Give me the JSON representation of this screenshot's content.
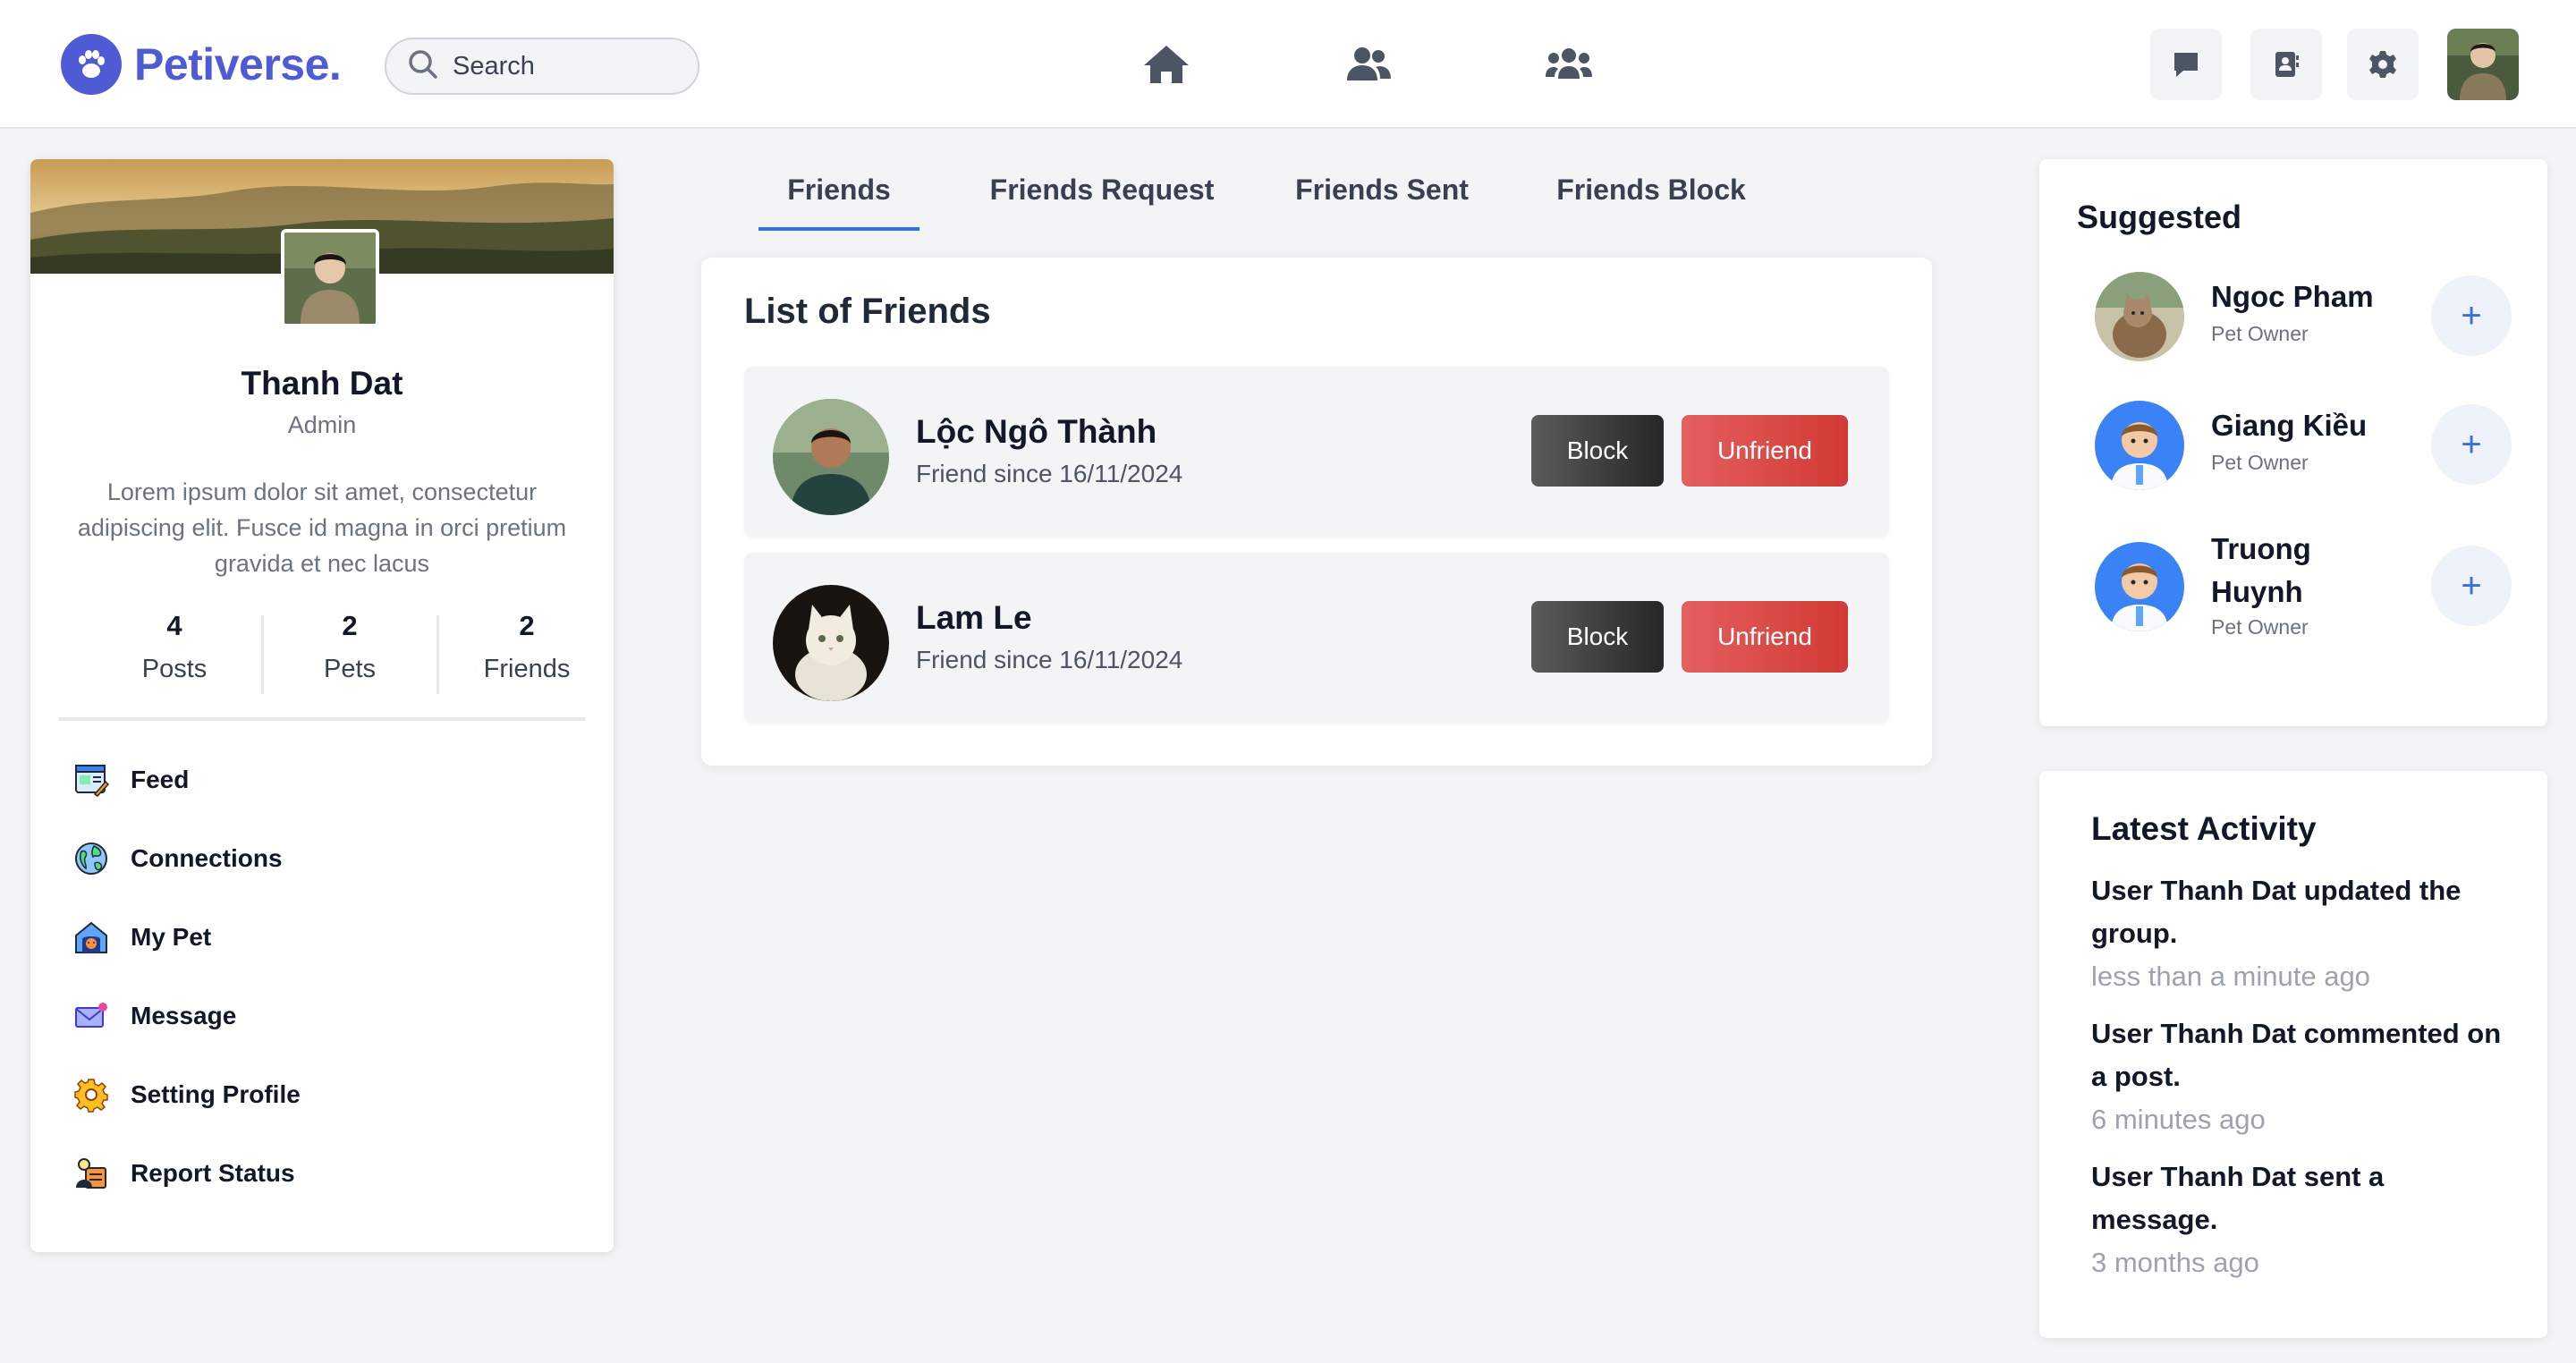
{
  "brand": {
    "name": "Petiverse.",
    "color": "#4f5bd5"
  },
  "search": {
    "placeholder": "Search"
  },
  "nav": {
    "icons": [
      "home-icon",
      "friends-icon",
      "groups-icon"
    ]
  },
  "header_actions": [
    "message-icon",
    "contacts-icon",
    "settings-icon",
    "user-avatar"
  ],
  "profile": {
    "name": "Thanh Dat",
    "role": "Admin",
    "bio": "Lorem ipsum dolor sit amet, consectetur adipiscing elit. Fusce id magna in orci pretium gravida et nec lacus",
    "stats": [
      {
        "value": "4",
        "label": "Posts"
      },
      {
        "value": "2",
        "label": "Pets"
      },
      {
        "value": "2",
        "label": "Friends"
      }
    ]
  },
  "menu": [
    {
      "label": "Feed",
      "icon": "feed-icon"
    },
    {
      "label": "Connections",
      "icon": "globe-icon"
    },
    {
      "label": "My Pet",
      "icon": "pet-house-icon"
    },
    {
      "label": "Message",
      "icon": "envelope-icon"
    },
    {
      "label": "Setting Profile",
      "icon": "gear-icon"
    },
    {
      "label": "Report Status",
      "icon": "report-icon"
    }
  ],
  "tabs": [
    {
      "label": "Friends",
      "active": true
    },
    {
      "label": "Friends Request",
      "active": false
    },
    {
      "label": "Friends Sent",
      "active": false
    },
    {
      "label": "Friends Block",
      "active": false
    }
  ],
  "friends_list": {
    "title": "List of Friends",
    "block_label": "Block",
    "unfriend_label": "Unfriend",
    "items": [
      {
        "name": "Lộc Ngô Thành",
        "since": "Friend since 16/11/2024"
      },
      {
        "name": "Lam Le",
        "since": "Friend since 16/11/2024"
      }
    ]
  },
  "suggested": {
    "title": "Suggested",
    "items": [
      {
        "name": "Ngoc Pham",
        "role": "Pet Owner"
      },
      {
        "name": "Giang Kiều",
        "role": "Pet Owner"
      },
      {
        "name": "Truong Huynh",
        "role": "Pet Owner"
      }
    ]
  },
  "activity": {
    "title": "Latest Activity",
    "items": [
      {
        "text": "User Thanh Dat updated the group.",
        "time": "less than a minute ago"
      },
      {
        "text": "User Thanh Dat commented on a post.",
        "time": "6 minutes ago"
      },
      {
        "text": "User Thanh Dat sent a message.",
        "time": "3 months ago"
      }
    ]
  },
  "colors": {
    "accent": "#3b6fd6",
    "danger": "#d23a34",
    "dark": "#262626",
    "background": "#f3f4f6"
  }
}
